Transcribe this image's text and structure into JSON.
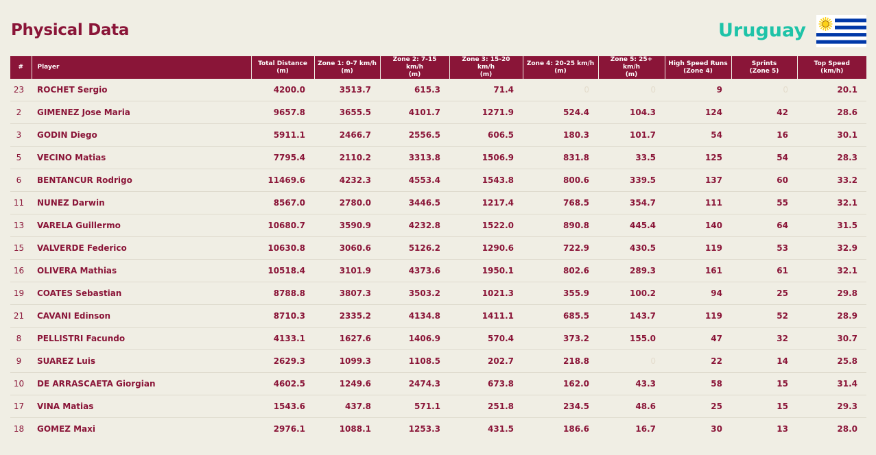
{
  "header": {
    "title": "Physical Data",
    "country": "Uruguay",
    "flag_icon": "uruguay-flag-icon"
  },
  "colors": {
    "brand": "#8a1538",
    "country_accent": "#1ec3a8",
    "background": "#f0eee4",
    "flag_blue": "#0038a8",
    "flag_sun": "#fcd116"
  },
  "table": {
    "columns": [
      "#",
      "Player",
      "Total Distance\n(m)",
      "Zone 1: 0-7 km/h\n(m)",
      "Zone 2: 7-15 km/h\n(m)",
      "Zone 3: 15-20 km/h\n(m)",
      "Zone 4: 20-25 km/h\n(m)",
      "Zone 5: 25+ km/h\n(m)",
      "High Speed Runs\n(Zone 4)",
      "Sprints\n(Zone 5)",
      "Top Speed\n(km/h)"
    ],
    "rows": [
      [
        "23",
        "ROCHET Sergio",
        "4200.0",
        "3513.7",
        "615.3",
        "71.4",
        "0",
        "0",
        "9",
        "0",
        "20.1"
      ],
      [
        "2",
        "GIMENEZ Jose Maria",
        "9657.8",
        "3655.5",
        "4101.7",
        "1271.9",
        "524.4",
        "104.3",
        "124",
        "42",
        "28.6"
      ],
      [
        "3",
        "GODIN Diego",
        "5911.1",
        "2466.7",
        "2556.5",
        "606.5",
        "180.3",
        "101.7",
        "54",
        "16",
        "30.1"
      ],
      [
        "5",
        "VECINO Matias",
        "7795.4",
        "2110.2",
        "3313.8",
        "1506.9",
        "831.8",
        "33.5",
        "125",
        "54",
        "28.3"
      ],
      [
        "6",
        "BENTANCUR Rodrigo",
        "11469.6",
        "4232.3",
        "4553.4",
        "1543.8",
        "800.6",
        "339.5",
        "137",
        "60",
        "33.2"
      ],
      [
        "11",
        "NUNEZ Darwin",
        "8567.0",
        "2780.0",
        "3446.5",
        "1217.4",
        "768.5",
        "354.7",
        "111",
        "55",
        "32.1"
      ],
      [
        "13",
        "VARELA Guillermo",
        "10680.7",
        "3590.9",
        "4232.8",
        "1522.0",
        "890.8",
        "445.4",
        "140",
        "64",
        "31.5"
      ],
      [
        "15",
        "VALVERDE Federico",
        "10630.8",
        "3060.6",
        "5126.2",
        "1290.6",
        "722.9",
        "430.5",
        "119",
        "53",
        "32.9"
      ],
      [
        "16",
        "OLIVERA Mathias",
        "10518.4",
        "3101.9",
        "4373.6",
        "1950.1",
        "802.6",
        "289.3",
        "161",
        "61",
        "32.1"
      ],
      [
        "19",
        "COATES Sebastian",
        "8788.8",
        "3807.3",
        "3503.2",
        "1021.3",
        "355.9",
        "100.2",
        "94",
        "25",
        "29.8"
      ],
      [
        "21",
        "CAVANI Edinson",
        "8710.3",
        "2335.2",
        "4134.8",
        "1411.1",
        "685.5",
        "143.7",
        "119",
        "52",
        "28.9"
      ],
      [
        "8",
        "PELLISTRI Facundo",
        "4133.1",
        "1627.6",
        "1406.9",
        "570.4",
        "373.2",
        "155.0",
        "47",
        "32",
        "30.7"
      ],
      [
        "9",
        "SUAREZ Luis",
        "2629.3",
        "1099.3",
        "1108.5",
        "202.7",
        "218.8",
        "0",
        "22",
        "14",
        "25.8"
      ],
      [
        "10",
        "DE ARRASCAETA Giorgian",
        "4602.5",
        "1249.6",
        "2474.3",
        "673.8",
        "162.0",
        "43.3",
        "58",
        "15",
        "31.4"
      ],
      [
        "17",
        "VINA Matias",
        "1543.6",
        "437.8",
        "571.1",
        "251.8",
        "234.5",
        "48.6",
        "25",
        "15",
        "29.3"
      ],
      [
        "18",
        "GOMEZ Maxi",
        "2976.1",
        "1088.1",
        "1253.3",
        "431.5",
        "186.6",
        "16.7",
        "30",
        "13",
        "28.0"
      ]
    ]
  }
}
